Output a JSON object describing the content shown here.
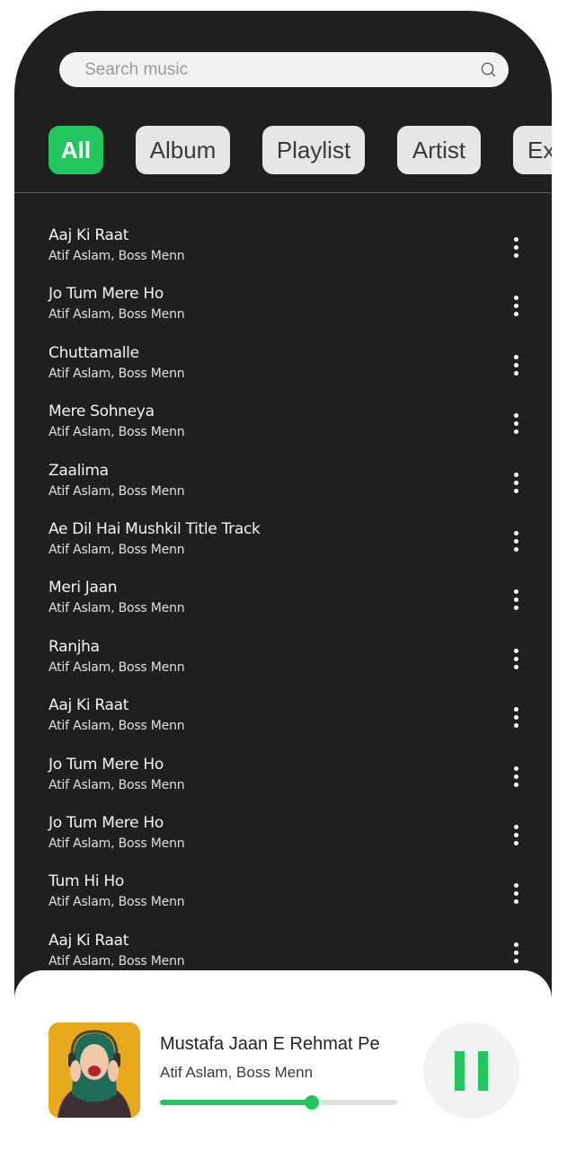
{
  "search": {
    "placeholder": "Search music",
    "value": ""
  },
  "filters": {
    "chips": [
      {
        "label": "All",
        "active": true
      },
      {
        "label": "Album",
        "active": false
      },
      {
        "label": "Playlist",
        "active": false
      },
      {
        "label": "Artist",
        "active": false
      },
      {
        "label": "Ex",
        "active": false
      }
    ]
  },
  "songs": [
    {
      "title": "Aaj Ki Raat",
      "artist": "Atif Aslam, Boss Menn"
    },
    {
      "title": "Jo Tum Mere Ho",
      "artist": "Atif Aslam, Boss Menn"
    },
    {
      "title": "Chuttamalle",
      "artist": "Atif Aslam, Boss Menn"
    },
    {
      "title": "Mere Sohneya",
      "artist": "Atif Aslam, Boss Menn"
    },
    {
      "title": "Zaalima",
      "artist": "Atif Aslam, Boss Menn"
    },
    {
      "title": "Ae Dil Hai Mushkil Title Track",
      "artist": "Atif Aslam, Boss Menn"
    },
    {
      "title": "Meri Jaan",
      "artist": "Atif Aslam, Boss Menn"
    },
    {
      "title": "Ranjha",
      "artist": "Atif Aslam, Boss Menn"
    },
    {
      "title": "Aaj Ki Raat",
      "artist": "Atif Aslam, Boss Menn"
    },
    {
      "title": "Jo Tum Mere Ho",
      "artist": "Atif Aslam, Boss Menn"
    },
    {
      "title": "Jo Tum Mere Ho",
      "artist": "Atif Aslam, Boss Menn"
    },
    {
      "title": "Tum Hi Ho",
      "artist": "Atif Aslam, Boss Menn"
    },
    {
      "title": "Aaj Ki Raat",
      "artist": "Atif Aslam, Boss Menn"
    }
  ],
  "now_playing": {
    "title": "Mustafa Jaan E Rehmat Pe",
    "artist": "Atif Aslam, Boss Menn",
    "progress_percent": 64,
    "state": "playing",
    "control_icon": "pause-icon"
  },
  "colors": {
    "accent": "#22c55e",
    "background": "#1f1f1f",
    "chip": "#e6e6e6"
  }
}
